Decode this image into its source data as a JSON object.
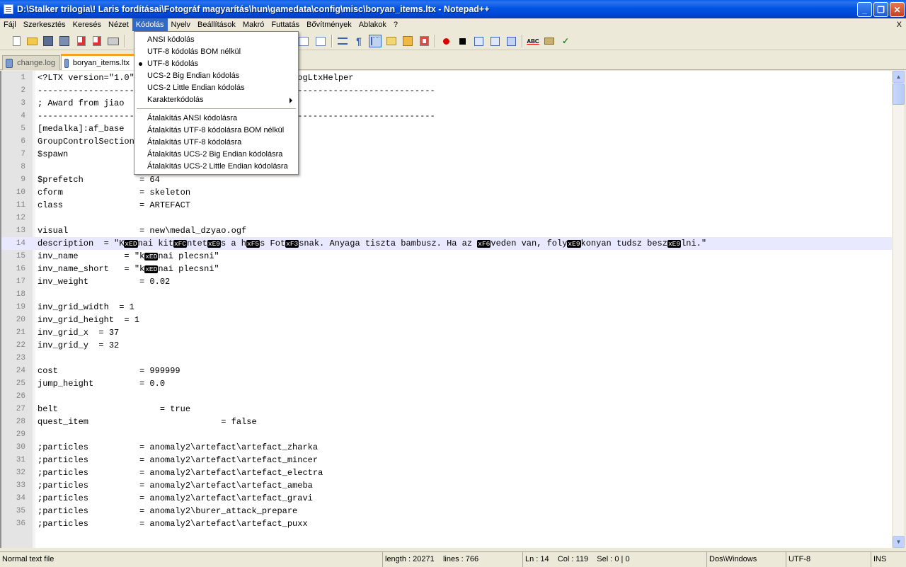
{
  "window": {
    "title": "D:\\Stalker trilogia\\! Laris fordításai\\Fotográf magyarítás\\hun\\gamedata\\config\\misc\\boryan_items.ltx - Notepad++",
    "minimize": "_",
    "maximize": "❐",
    "close": "✕"
  },
  "menubar": {
    "items": [
      "Fájl",
      "Szerkesztés",
      "Keresés",
      "Nézet",
      "Kódolás",
      "Nyelv",
      "Beállítások",
      "Makró",
      "Futtatás",
      "Bővítmények",
      "Ablakok",
      "?"
    ],
    "active": "Kódolás",
    "close_doc": "X"
  },
  "tabs": [
    {
      "label": "change.log",
      "active": false
    },
    {
      "label": "boryan_items.ltx",
      "active": true
    }
  ],
  "encoding_menu": {
    "items": [
      {
        "label": "ANSI kódolás"
      },
      {
        "label": "UTF-8 kódolás BOM nélkül"
      },
      {
        "label": "UTF-8 kódolás",
        "checked": true
      },
      {
        "label": "UCS-2 Big Endian kódolás"
      },
      {
        "label": "UCS-2 Little Endian kódolás"
      },
      {
        "label": "Karakterkódolás",
        "submenu": true
      },
      {
        "label": "Átalakítás ANSI kódolásra"
      },
      {
        "label": "Átalakítás UTF-8 kódolásra BOM nélkül"
      },
      {
        "label": "Átalakítás UTF-8 kódolásra"
      },
      {
        "label": "Átalakítás UCS-2 Big Endian kódolásra"
      },
      {
        "label": "Átalakítás UCS-2 Little Endian kódolásra"
      }
    ]
  },
  "editor": {
    "current_line": 14,
    "lines": [
      {
        "n": "1",
        "text": "<?LTX version=\"1.0\" encoding=\"UTF-8\"?>; StalkerDialogLtxHelper"
      },
      {
        "n": "2",
        "text": "------------------------------------------------------------------------------"
      },
      {
        "n": "3",
        "text": "; Award from jiao"
      },
      {
        "n": "4",
        "text": "------------------------------------------------------------------------------"
      },
      {
        "n": "5",
        "text": "[medalka]:af_base"
      },
      {
        "n": "6",
        "text": "GroupControlSection"
      },
      {
        "n": "7",
        "text": "$spawn"
      },
      {
        "n": "8",
        "text": ""
      },
      {
        "n": "9",
        "text": "$prefetch           = 64"
      },
      {
        "n": "10",
        "text": "cform               = skeleton"
      },
      {
        "n": "11",
        "text": "class               = ARTEFACT"
      },
      {
        "n": "12",
        "text": ""
      },
      {
        "n": "13",
        "text": "visual              = new\\medal_dzyao.ogf"
      },
      {
        "n": "14",
        "segments": [
          "description  = \"K",
          "#xED",
          "nai kit",
          "#xFC",
          "ntet",
          "#xE9",
          "s a h",
          "#xF5",
          "s Fot",
          "#xF3",
          "snak. Anyaga tiszta bambusz. Ha az ",
          "#xF6",
          "veden van, foly",
          "#xE9",
          "konyan tudsz besz",
          "#xE9",
          "lni.\""
        ]
      },
      {
        "n": "15",
        "segments": [
          "inv_name         = \"k",
          "#xED",
          "nai plecsni\""
        ]
      },
      {
        "n": "16",
        "segments": [
          "inv_name_short   = \"k",
          "#xED",
          "nai plecsni\""
        ]
      },
      {
        "n": "17",
        "text": "inv_weight          = 0.02"
      },
      {
        "n": "18",
        "text": ""
      },
      {
        "n": "19",
        "text": "inv_grid_width  = 1"
      },
      {
        "n": "20",
        "text": "inv_grid_height  = 1"
      },
      {
        "n": "21",
        "text": "inv_grid_x  = 37"
      },
      {
        "n": "22",
        "text": "inv_grid_y  = 32"
      },
      {
        "n": "23",
        "text": ""
      },
      {
        "n": "24",
        "text": "cost                = 999999"
      },
      {
        "n": "25",
        "text": "jump_height         = 0.0"
      },
      {
        "n": "26",
        "text": ""
      },
      {
        "n": "27",
        "text": "belt                    = true"
      },
      {
        "n": "28",
        "text": "quest_item                          = false"
      },
      {
        "n": "29",
        "text": ""
      },
      {
        "n": "30",
        "text": ";particles          = anomaly2\\artefact\\artefact_zharka"
      },
      {
        "n": "31",
        "text": ";particles          = anomaly2\\artefact\\artefact_mincer"
      },
      {
        "n": "32",
        "text": ";particles          = anomaly2\\artefact\\artefact_electra"
      },
      {
        "n": "33",
        "text": ";particles          = anomaly2\\artefact\\artefact_ameba"
      },
      {
        "n": "34",
        "text": ";particles          = anomaly2\\artefact\\artefact_gravi"
      },
      {
        "n": "35",
        "text": ";particles          = anomaly2\\burer_attack_prepare"
      },
      {
        "n": "36",
        "text": ";particles          = anomaly2\\artefact\\artefact_puxx"
      }
    ]
  },
  "statusbar": {
    "file_type": "Normal text file",
    "length": "length : 20271    lines : 766",
    "position": "Ln : 14    Col : 119    Sel : 0 | 0",
    "eol": "Dos\\Windows",
    "encoding": "UTF-8",
    "mode": "INS"
  },
  "colors": {
    "title_blue": "#0054e3",
    "menu_highlight": "#316ac5",
    "current_line": "#e8e8ff",
    "tab_accent": "#f6a21d"
  }
}
